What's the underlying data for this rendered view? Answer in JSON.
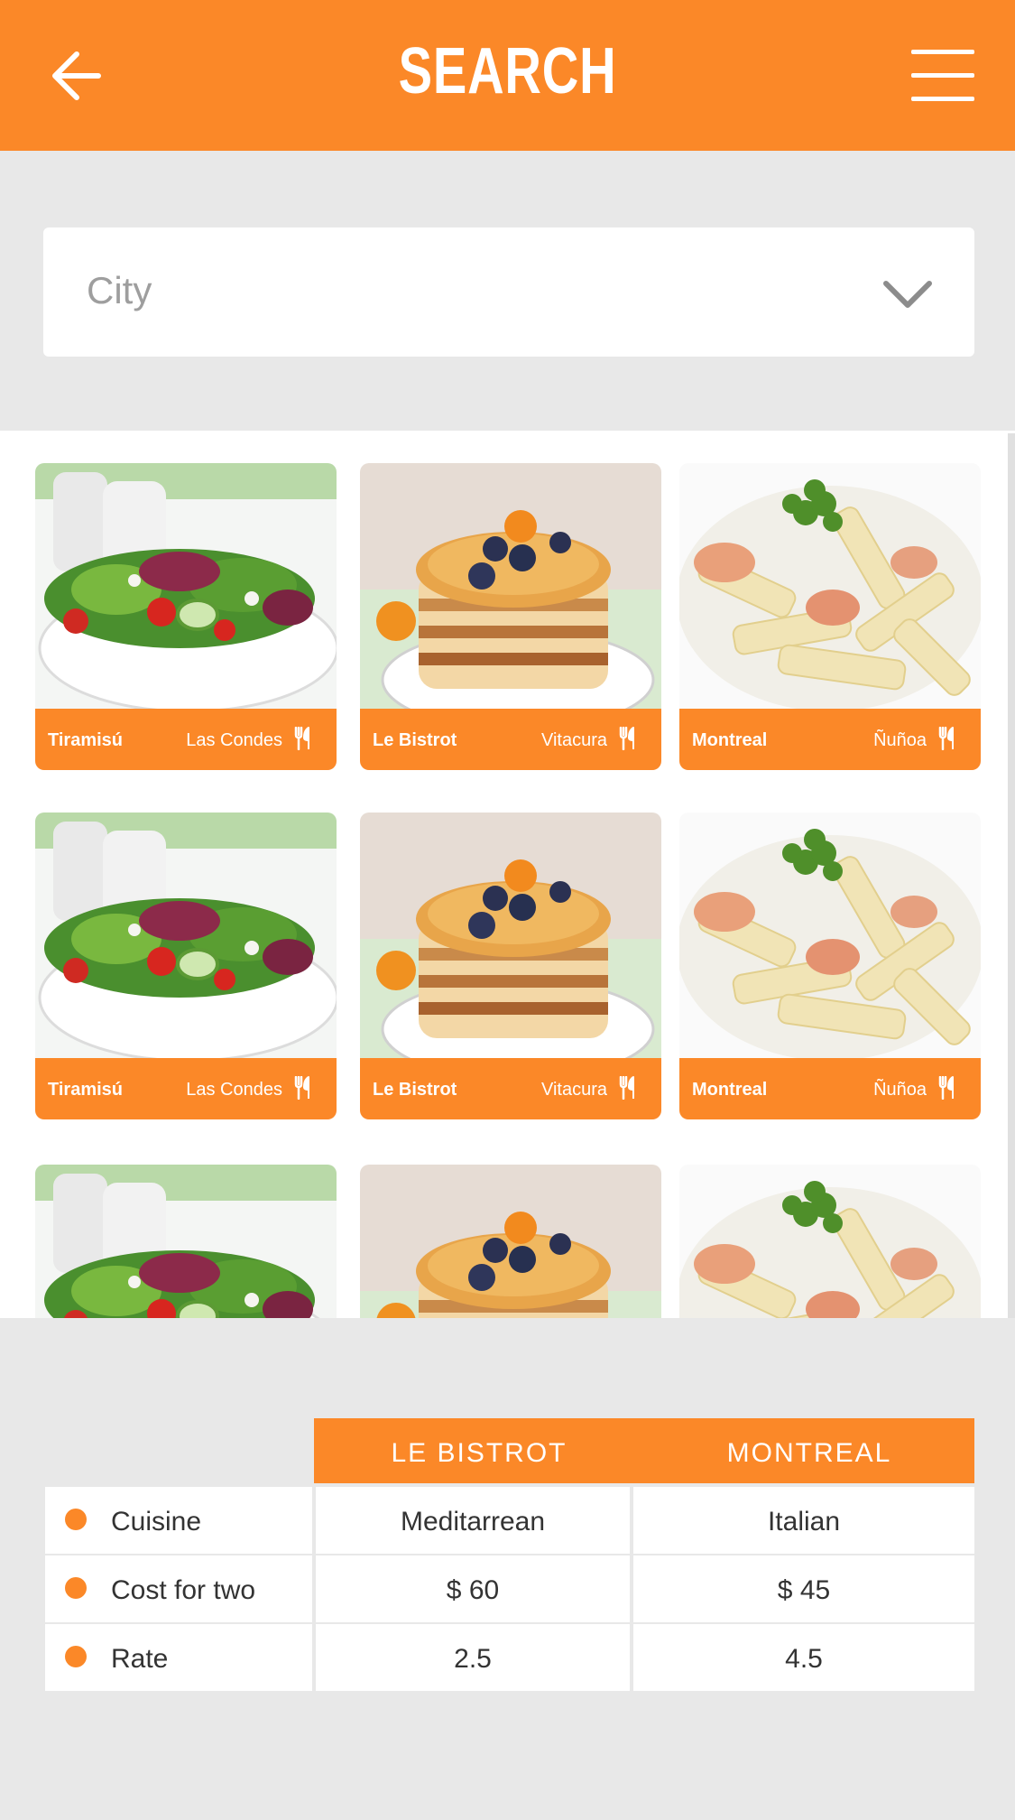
{
  "header": {
    "title": "SEARCH",
    "background_color": "#fb8828"
  },
  "city_select": {
    "placeholder": "City",
    "icon": "chevron-down-icon"
  },
  "restaurants": [
    {
      "name": "Tiramisú",
      "location": "Las Condes",
      "image": "salad",
      "icon": "fork-knife-icon"
    },
    {
      "name": "Le Bistrot",
      "location": "Vitacura",
      "image": "pancakes",
      "icon": "fork-knife-icon"
    },
    {
      "name": "Montreal",
      "location": "Ñuñoa",
      "image": "pasta",
      "icon": "fork-knife-icon"
    },
    {
      "name": "Tiramisú",
      "location": "Las Condes",
      "image": "salad",
      "icon": "fork-knife-icon"
    },
    {
      "name": "Le Bistrot",
      "location": "Vitacura",
      "image": "pancakes",
      "icon": "fork-knife-icon"
    },
    {
      "name": "Montreal",
      "location": "Ñuñoa",
      "image": "pasta",
      "icon": "fork-knife-icon"
    }
  ],
  "compare": {
    "columns": [
      "LE BISTROT",
      "MONTREAL"
    ],
    "rows": [
      {
        "label": "Cuisine",
        "values": [
          "Meditarrean",
          "Italian"
        ]
      },
      {
        "label": "Cost for two",
        "values": [
          "$ 60",
          "$ 45"
        ]
      },
      {
        "label": "Rate",
        "values": [
          "2.5",
          "4.5"
        ]
      }
    ]
  }
}
